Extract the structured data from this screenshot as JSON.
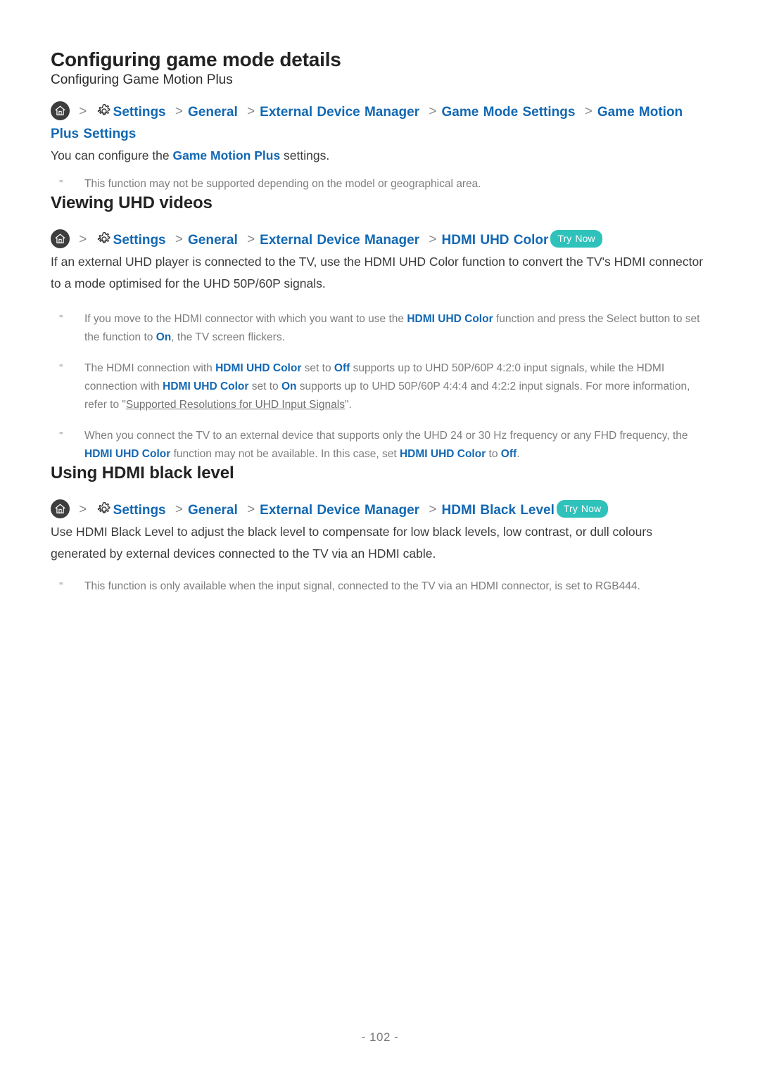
{
  "document": {
    "title": "Configuring game mode details",
    "page_number": "- 102 -"
  },
  "icons": {
    "home": "home-icon",
    "gear": "gear-icon",
    "chevron": "chevron-right-icon"
  },
  "colors": {
    "link_blue": "#1268b3",
    "try_now_teal": "#2ec2bb",
    "body_text": "#3a3a3a",
    "note_text": "#7d7d7d",
    "home_circle": "#3d3d3d"
  },
  "separator": ">",
  "note_marker": "\"",
  "sections": [
    {
      "id": "game-motion-plus",
      "subheading": "Configuring Game Motion Plus",
      "breadcrumb": {
        "home": true,
        "gear": true,
        "crumbs": [
          "Settings",
          "General",
          "External Device Manager",
          "Game Mode Settings",
          "Game Motion Plus Settings"
        ],
        "try_now": null
      },
      "body": {
        "before": "You can configure the ",
        "highlight": "Game Motion Plus",
        "after": " settings."
      },
      "notes": [
        "This function may not be supported depending on the model or geographical area."
      ]
    },
    {
      "id": "viewing-uhd-videos",
      "heading": "Viewing UHD videos",
      "breadcrumb": {
        "home": true,
        "gear": true,
        "crumbs": [
          "Settings",
          "General",
          "External Device Manager",
          "HDMI UHD Color"
        ],
        "try_now": "Try Now"
      },
      "body": "If an external UHD player is connected to the TV, use the HDMI UHD Color function to convert the TV's HDMI connector to a mode optimised for the UHD 50P/60P signals.",
      "notes": [
        {
          "parts": [
            {
              "t": "If you move to the HDMI connector with which you want to use the ",
              "hl": false
            },
            {
              "t": "HDMI UHD Color",
              "hl": true
            },
            {
              "t": " function and press the Select button to set the function to ",
              "hl": false
            },
            {
              "t": "On",
              "hl": true
            },
            {
              "t": ", the TV screen flickers.",
              "hl": false
            }
          ]
        },
        {
          "parts": [
            {
              "t": "The HDMI connection with ",
              "hl": false
            },
            {
              "t": "HDMI UHD Color",
              "hl": true
            },
            {
              "t": " set to ",
              "hl": false
            },
            {
              "t": "Off",
              "hl": true
            },
            {
              "t": " supports up to UHD 50P/60P 4:2:0 input signals, while the HDMI connection with ",
              "hl": false
            },
            {
              "t": "HDMI UHD Color",
              "hl": true
            },
            {
              "t": " set to ",
              "hl": false
            },
            {
              "t": "On",
              "hl": true
            },
            {
              "t": " supports up to UHD 50P/60P 4:4:4 and 4:2:2 input signals. For more information, refer to \"",
              "hl": false
            },
            {
              "t": "Supported Resolutions for UHD Input Signals",
              "hl": false,
              "link": true
            },
            {
              "t": "\".",
              "hl": false
            }
          ]
        },
        {
          "parts": [
            {
              "t": "When you connect the TV to an external device that supports only the UHD 24 or 30 Hz frequency or any FHD frequency, the ",
              "hl": false
            },
            {
              "t": "HDMI UHD Color",
              "hl": true
            },
            {
              "t": " function may not be available. In this case, set ",
              "hl": false
            },
            {
              "t": "HDMI UHD Color",
              "hl": true
            },
            {
              "t": " to ",
              "hl": false
            },
            {
              "t": "Off",
              "hl": true
            },
            {
              "t": ".",
              "hl": false
            }
          ]
        }
      ]
    },
    {
      "id": "using-hdmi-black-level",
      "heading": "Using HDMI black level",
      "breadcrumb": {
        "home": true,
        "gear": true,
        "crumbs": [
          "Settings",
          "General",
          "External Device Manager",
          "HDMI Black Level"
        ],
        "try_now": "Try Now"
      },
      "body": "Use HDMI Black Level to adjust the black level to compensate for low black levels, low contrast, or dull colours generated by external devices connected to the TV via an HDMI cable.",
      "notes": [
        "This function is only available when the input signal, connected to the TV via an HDMI connector, is set to RGB444."
      ]
    }
  ]
}
